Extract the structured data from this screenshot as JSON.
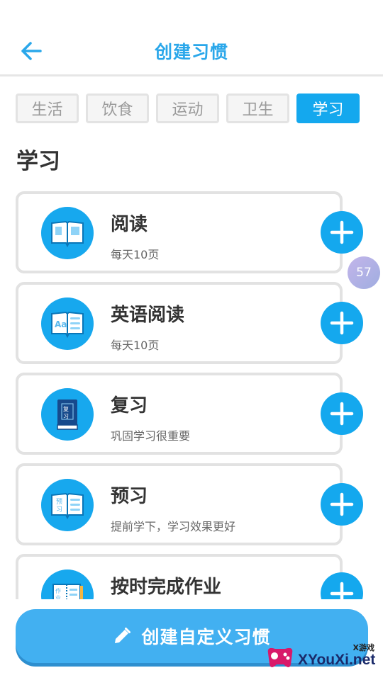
{
  "header": {
    "title": "创建习惯"
  },
  "tabs": [
    {
      "label": "生活",
      "active": false
    },
    {
      "label": "饮食",
      "active": false
    },
    {
      "label": "运动",
      "active": false
    },
    {
      "label": "卫生",
      "active": false
    },
    {
      "label": "学习",
      "active": true
    }
  ],
  "section": {
    "title": "学习"
  },
  "habits": [
    {
      "name": "阅读",
      "desc": "每天10页",
      "icon": "open-book-icon"
    },
    {
      "name": "英语阅读",
      "desc": "每天10页",
      "icon": "english-book-icon"
    },
    {
      "name": "复习",
      "desc": "巩固学习很重要",
      "icon": "review-book-icon"
    },
    {
      "name": "预习",
      "desc": "提前学下，学习效果更好",
      "icon": "preview-book-icon"
    },
    {
      "name": "按时完成作业",
      "desc": "",
      "icon": "homework-notebook-icon"
    }
  ],
  "bubble": {
    "count": "57"
  },
  "footer": {
    "create_label": "创建自定义习惯"
  },
  "watermark": {
    "small": "X游戏",
    "big": "XYouXi.net"
  },
  "colors": {
    "accent": "#14a8ee",
    "title": "#2aa7ea",
    "border": "#e2e2e2"
  }
}
